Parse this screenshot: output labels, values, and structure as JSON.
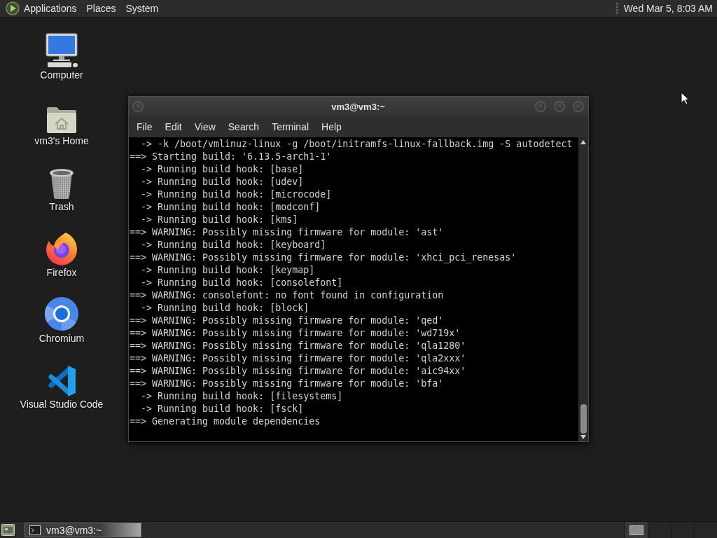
{
  "top_panel": {
    "menus": [
      "Applications",
      "Places",
      "System"
    ],
    "clock": "Wed Mar 5, 8:03 AM"
  },
  "desktop_icons": [
    {
      "label": "Computer",
      "kind": "computer"
    },
    {
      "label": "vm3's Home",
      "kind": "home"
    },
    {
      "label": "Trash",
      "kind": "trash"
    },
    {
      "label": "Firefox",
      "kind": "firefox"
    },
    {
      "label": "Chromium",
      "kind": "chromium"
    },
    {
      "label": "Visual Studio Code",
      "kind": "vscode"
    }
  ],
  "window": {
    "title": "vm3@vm3:~",
    "menu": [
      "File",
      "Edit",
      "View",
      "Search",
      "Terminal",
      "Help"
    ],
    "lines": [
      "  -> -k /boot/vmlinuz-linux -g /boot/initramfs-linux-fallback.img -S autodetect",
      "==> Starting build: '6.13.5-arch1-1'",
      "  -> Running build hook: [base]",
      "  -> Running build hook: [udev]",
      "  -> Running build hook: [microcode]",
      "  -> Running build hook: [modconf]",
      "  -> Running build hook: [kms]",
      "==> WARNING: Possibly missing firmware for module: 'ast'",
      "  -> Running build hook: [keyboard]",
      "==> WARNING: Possibly missing firmware for module: 'xhci_pci_renesas'",
      "  -> Running build hook: [keymap]",
      "  -> Running build hook: [consolefont]",
      "==> WARNING: consolefont: no font found in configuration",
      "  -> Running build hook: [block]",
      "==> WARNING: Possibly missing firmware for module: 'qed'",
      "==> WARNING: Possibly missing firmware for module: 'wd719x'",
      "==> WARNING: Possibly missing firmware for module: 'qla1280'",
      "==> WARNING: Possibly missing firmware for module: 'qla2xxx'",
      "==> WARNING: Possibly missing firmware for module: 'aic94xx'",
      "==> WARNING: Possibly missing firmware for module: 'bfa'",
      "  -> Running build hook: [filesystems]",
      "  -> Running build hook: [fsck]",
      "==> Generating module dependencies"
    ]
  },
  "taskbar": {
    "buttons": [
      {
        "label": "vm3@vm3:~",
        "selected": true
      }
    ],
    "workspaces": [
      {
        "selected": true
      },
      {
        "selected": false
      },
      {
        "selected": false
      },
      {
        "selected": false
      }
    ]
  }
}
